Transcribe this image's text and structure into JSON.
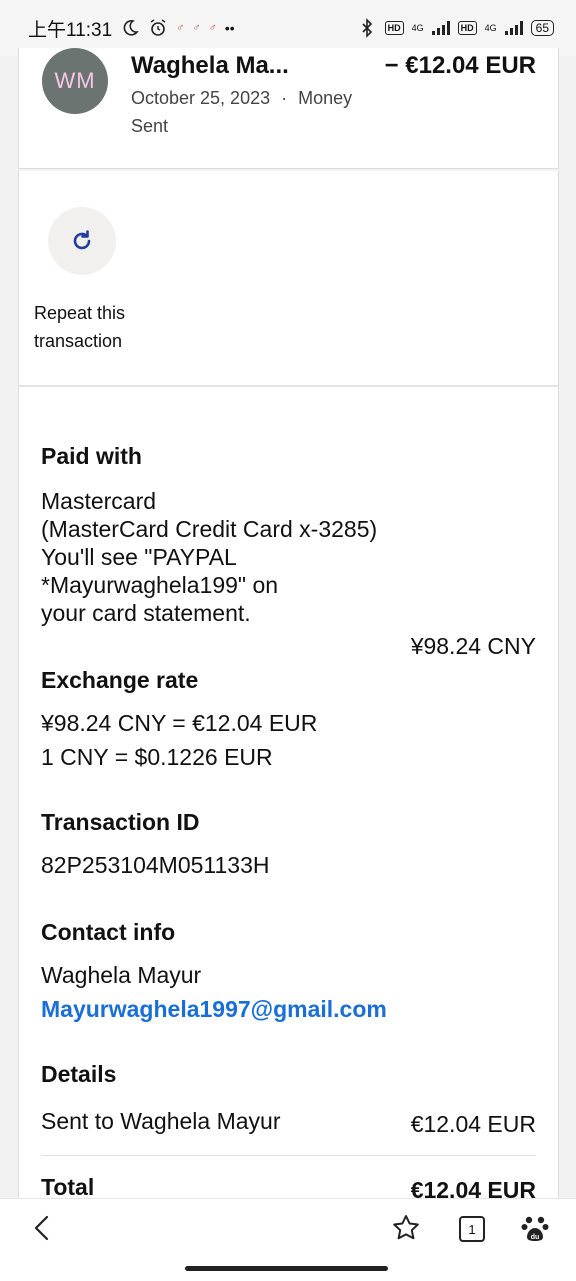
{
  "status_bar": {
    "time": "上午11:31",
    "network_1": "4G",
    "network_2": "4G",
    "hd_1": "HD",
    "hd_2": "HD",
    "battery": "65"
  },
  "transaction": {
    "avatar_initials": "WM",
    "name": "Waghela Ma...",
    "amount": "− €12.04 EUR",
    "date": "October 25, 2023",
    "separator": "·",
    "type": "Money Sent"
  },
  "repeat": {
    "label": "Repeat this transaction"
  },
  "paid_with": {
    "title": "Paid with",
    "line1": "Mastercard",
    "line2": "(MasterCard Credit Card x-3285)",
    "line3": "You'll see \"PAYPAL",
    "line4": "*Mayurwaghela199\" on",
    "line5": "your card statement.",
    "amount": "¥98.24 CNY"
  },
  "exchange_rate": {
    "title": "Exchange rate",
    "line1": "¥98.24 CNY = €12.04 EUR",
    "line2": "1 CNY = $0.1226 EUR"
  },
  "transaction_id": {
    "title": "Transaction ID",
    "value": "82P253104M051133H"
  },
  "contact_info": {
    "title": "Contact info",
    "name": "Waghela Mayur",
    "email": "Mayurwaghela1997@gmail.com"
  },
  "details": {
    "title": "Details",
    "sent_to": "Sent to Waghela Mayur",
    "sent_amount": "€12.04 EUR"
  },
  "total": {
    "label": "Total",
    "amount": "€12.04 EUR"
  },
  "bottom_bar": {
    "tabs_count": "1"
  },
  "colors": {
    "link": "#1a6fd6",
    "avatar_bg": "#6b7470",
    "avatar_text": "#f4c6e8",
    "repeat_icon": "#1f3c9e"
  }
}
